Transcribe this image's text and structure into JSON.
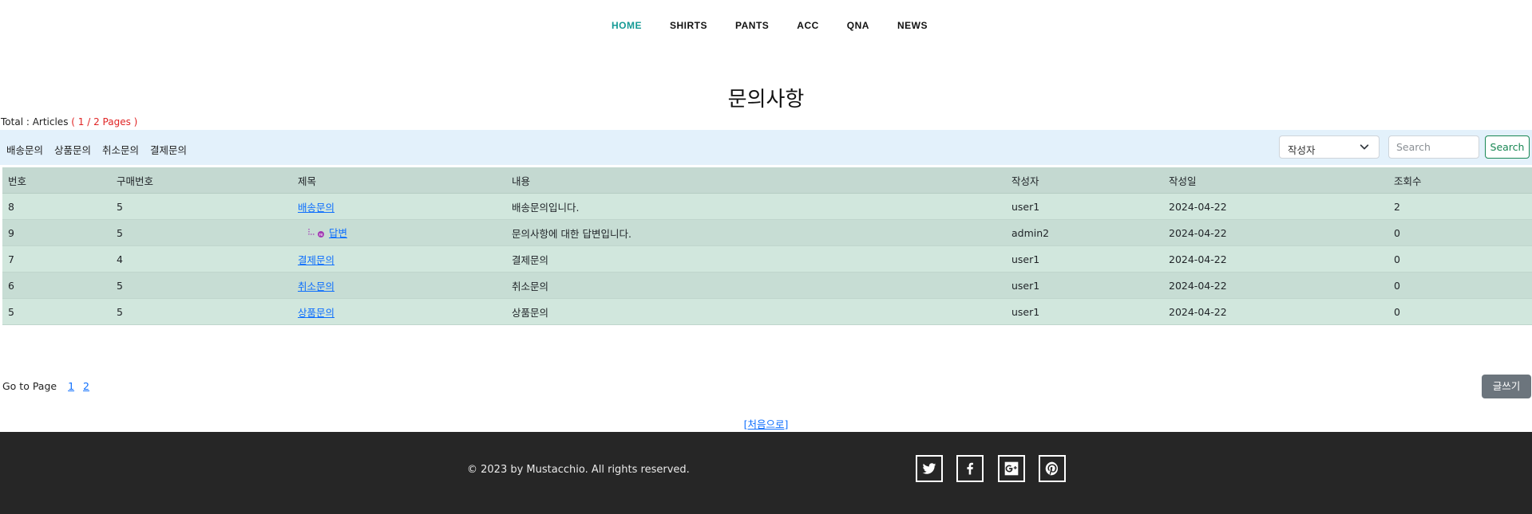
{
  "nav": {
    "items": [
      {
        "label": "HOME"
      },
      {
        "label": "SHIRTS"
      },
      {
        "label": "PANTS"
      },
      {
        "label": "ACC"
      },
      {
        "label": "QNA"
      },
      {
        "label": "NEWS"
      }
    ],
    "active_color": "#159a95"
  },
  "page_title": "문의사항",
  "summary": {
    "prefix": "Total : Articles",
    "pages": "( 1 / 2 Pages )"
  },
  "categories": [
    "배송문의",
    "상품문의",
    "취소문의",
    "결제문의"
  ],
  "search": {
    "field_selected": "작성자",
    "placeholder": "Search",
    "button_label": "Search"
  },
  "table": {
    "headers": [
      "번호",
      "구매번호",
      "제목",
      "내용",
      "작성자",
      "작성일",
      "조회수"
    ],
    "rows": [
      {
        "no": "8",
        "order": "5",
        "title": "배송문의",
        "content": "배송문의입니다.",
        "author": "user1",
        "date": "2024-04-22",
        "views": "2",
        "reply": false
      },
      {
        "no": "9",
        "order": "5",
        "title": "답변",
        "content": "문의사항에 대한 답변입니다.",
        "author": "admin2",
        "date": "2024-04-22",
        "views": "0",
        "reply": true
      },
      {
        "no": "7",
        "order": "4",
        "title": "결제문의",
        "content": "결제문의",
        "author": "user1",
        "date": "2024-04-22",
        "views": "0",
        "reply": false
      },
      {
        "no": "6",
        "order": "5",
        "title": "취소문의",
        "content": "취소문의",
        "author": "user1",
        "date": "2024-04-22",
        "views": "0",
        "reply": false
      },
      {
        "no": "5",
        "order": "5",
        "title": "상품문의",
        "content": "상품문의",
        "author": "user1",
        "date": "2024-04-22",
        "views": "0",
        "reply": false
      }
    ]
  },
  "pagination": {
    "label": "Go to Page",
    "pages": [
      "1",
      "2"
    ]
  },
  "write_button": "글쓰기",
  "first_link": "[처음으로]",
  "footer": {
    "copyright": "© 2023 by Mustacchio. All rights reserved.",
    "social_icons": [
      "twitter-icon",
      "facebook-icon",
      "google-plus-icon",
      "pinterest-icon"
    ]
  }
}
